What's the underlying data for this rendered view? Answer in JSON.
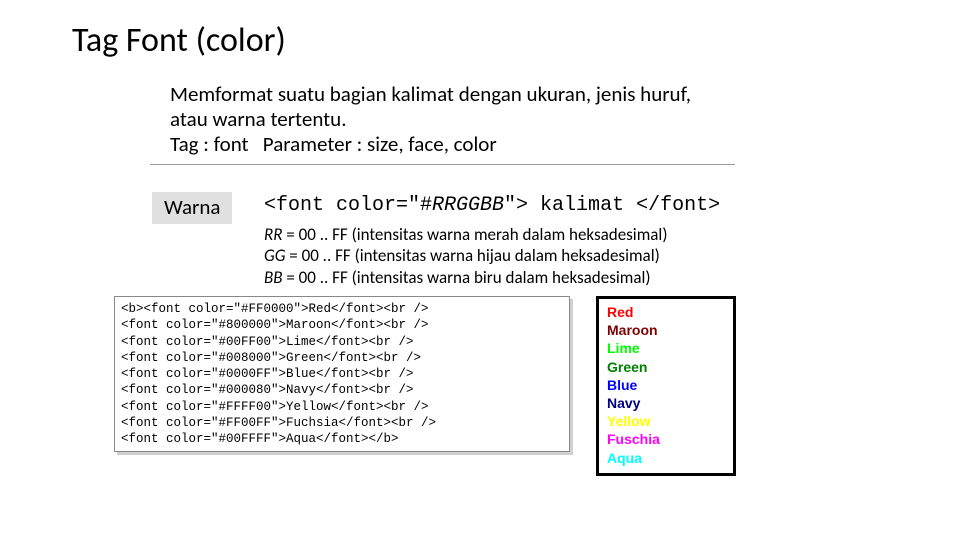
{
  "title": "Tag Font (color)",
  "desc_line1": "Memformat suatu bagian kalimat dengan ukuran, jenis huruf, atau warna tertentu.",
  "desc_line2": "Tag : font   Parameter : size, face, color",
  "warna_label": "Warna",
  "syntax_open": "<font color=\"#",
  "syntax_var": "RRGGBB",
  "syntax_close": "\"> kalimat </font>",
  "explain": {
    "rr_a": "RR",
    "rr_b": " = 00 .. FF (intensitas warna merah dalam heksadesimal)",
    "gg_a": "GG",
    "gg_b": " = 00 .. FF (intensitas warna hijau dalam heksadesimal)",
    "bb_a": "BB",
    "bb_b": " = 00 .. FF (intensitas warna biru dalam heksadesimal)"
  },
  "code": {
    "l1": "<b><font color=\"#FF0000\">Red</font><br />",
    "l2": "<font color=\"#800000\">Maroon</font><br />",
    "l3": "<font color=\"#00FF00\">Lime</font><br />",
    "l4": "<font color=\"#008000\">Green</font><br />",
    "l5": "<font color=\"#0000FF\">Blue</font><br />",
    "l6": "<font color=\"#000080\">Navy</font><br />",
    "l7": "<font color=\"#FFFF00\">Yellow</font><br />",
    "l8": "<font color=\"#FF00FF\">Fuchsia</font><br />",
    "l9": "<font color=\"#00FFFF\">Aqua</font></b>"
  },
  "out": [
    {
      "label": "Red",
      "color": "#FF0000"
    },
    {
      "label": "Maroon",
      "color": "#800000"
    },
    {
      "label": "Lime",
      "color": "#00FF00"
    },
    {
      "label": "Green",
      "color": "#008000"
    },
    {
      "label": "Blue",
      "color": "#0000FF"
    },
    {
      "label": "Navy",
      "color": "#000080"
    },
    {
      "label": "Yellow",
      "color": "#FFFF00"
    },
    {
      "label": "Fuschia",
      "color": "#FF00FF"
    },
    {
      "label": "Aqua",
      "color": "#00FFFF"
    }
  ]
}
